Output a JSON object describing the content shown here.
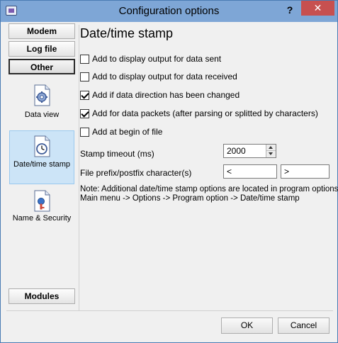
{
  "window": {
    "title": "Configuration options",
    "help_label": "?",
    "close_label": "✕"
  },
  "sidebar": {
    "top_buttons": [
      "Modem",
      "Log file",
      "Other"
    ],
    "items": [
      {
        "label": "Data view",
        "icon": "gear-document-icon"
      },
      {
        "label": "Date/time stamp",
        "icon": "clock-document-icon",
        "selected": true
      },
      {
        "label": "Name & Security",
        "icon": "key-document-icon"
      }
    ],
    "bottom_button": "Modules"
  },
  "content": {
    "title": "Date/time stamp",
    "checkboxes": [
      {
        "label": "Add to display output for data sent",
        "checked": false
      },
      {
        "label": "Add to display output for data received",
        "checked": false
      },
      {
        "label": "Add if data direction has been changed",
        "checked": true
      },
      {
        "label": "Add for data packets (after parsing or splitted by characters)",
        "checked": true
      },
      {
        "label": "Add at begin of file",
        "checked": false
      }
    ],
    "timeout_label": "Stamp timeout (ms)",
    "timeout_value": "2000",
    "prefix_label": "File prefix/postfix character(s)",
    "prefix_value": "<",
    "postfix_value": ">",
    "note_line1": "Note: Additional date/time stamp options are located in program options",
    "note_line2": "Main menu -> Options -> Program option -> Date/time stamp"
  },
  "buttons": {
    "ok": "OK",
    "cancel": "Cancel"
  }
}
